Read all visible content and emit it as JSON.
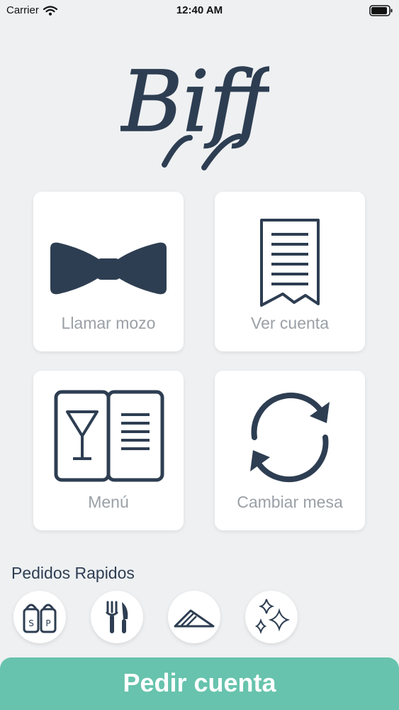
{
  "status_bar": {
    "carrier": "Carrier",
    "time": "12:40 AM"
  },
  "logo": {
    "text": "Biff"
  },
  "tiles": [
    {
      "label": "Llamar mozo",
      "icon": "bow-tie-icon"
    },
    {
      "label": "Ver cuenta",
      "icon": "receipt-icon"
    },
    {
      "label": "Menú",
      "icon": "menu-book-icon"
    },
    {
      "label": "Cambiar mesa",
      "icon": "refresh-icon"
    }
  ],
  "quick_orders": {
    "title": "Pedidos Rapidos",
    "items": [
      {
        "icon": "salt-pepper-icon",
        "letters": [
          "S",
          "P"
        ]
      },
      {
        "icon": "fork-knife-icon"
      },
      {
        "icon": "napkin-icon"
      },
      {
        "icon": "sparkle-icon"
      }
    ]
  },
  "cta": {
    "label": "Pedir cuenta"
  },
  "colors": {
    "background": "#eef0f2",
    "ink": "#2e3e52",
    "label_gray": "#9aa0a6",
    "accent": "#67c3ad"
  }
}
